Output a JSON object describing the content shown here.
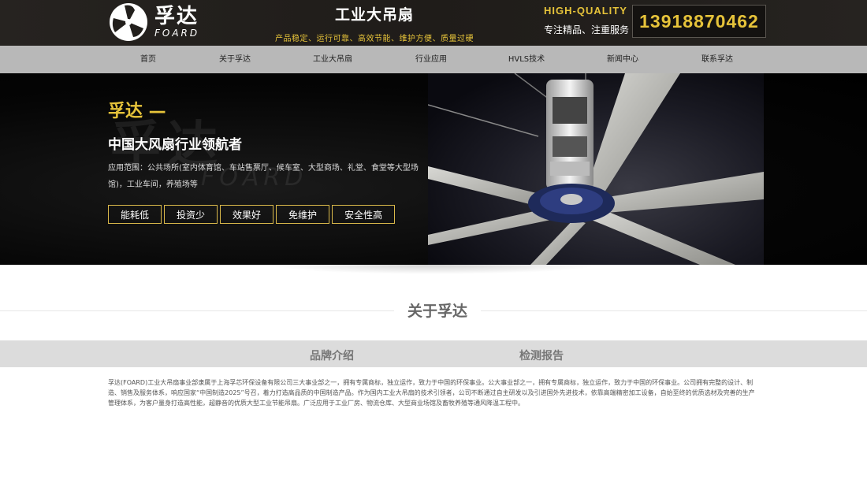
{
  "header": {
    "logo_cn": "孚达",
    "logo_en": "FOARD",
    "title": "工业大吊扇",
    "slogan": "产品稳定、运行可靠、高效节能、维护方便、质量过硬",
    "hq": "HIGH-QUALITY",
    "hq_sub": "专注精品、注重服务",
    "phone": "13918870462"
  },
  "nav": {
    "items": [
      {
        "label": "首页"
      },
      {
        "label": "关于孚达"
      },
      {
        "label": "工业大吊扇"
      },
      {
        "label": "行业应用"
      },
      {
        "label": "HVLS技术"
      },
      {
        "label": "新闻中心"
      },
      {
        "label": "联系孚达"
      }
    ]
  },
  "banner": {
    "headline": "孚达 —",
    "subheadline": "中国大风扇行业领航者",
    "description": "应用范围：公共场所(室内体育馆、车站售票厅、候车室、大型商场、礼堂、食堂等大型场馆)，工业车间，养殖场等",
    "tags": [
      "能耗低",
      "投资少",
      "效果好",
      "免维护",
      "安全性高"
    ],
    "watermark_cn": "孚达",
    "watermark_en": "FOARD"
  },
  "about": {
    "title": "关于孚达",
    "tabs": [
      {
        "label": "品牌介绍"
      },
      {
        "label": "检测报告"
      }
    ],
    "content": "孚达(FOARD)工业大吊扇事业部隶属于上海孚芯环保设备有限公司三大事业部之一，拥有专属商标，独立运作，致力于中国的环保事业。公大事业部之一，拥有专属商标，独立运作，致力于中国的环保事业。公司拥有完整的设计、制造、销售及服务体系，响应国家“中国制造2025”号召，着力打造高品质的中国制造产品。作为国内工业大吊扇的技术引领者，公司不断通过自主研发以及引进国外先进技术，依靠高端精密加工设备，自始至终的优质选材及完善的生产管理体系，为客户量身打造高性能，超静音的优质大型工业节能吊扇。广泛应用于工业厂房、物流仓库、大型商业场馆及畜牧养殖等通风降温工程中。"
  },
  "colors": {
    "gold": "#e6c33a",
    "header_bg": "#221f1c",
    "nav_bg": "#b8b8b8",
    "tab_bg": "#dcdcdc"
  }
}
